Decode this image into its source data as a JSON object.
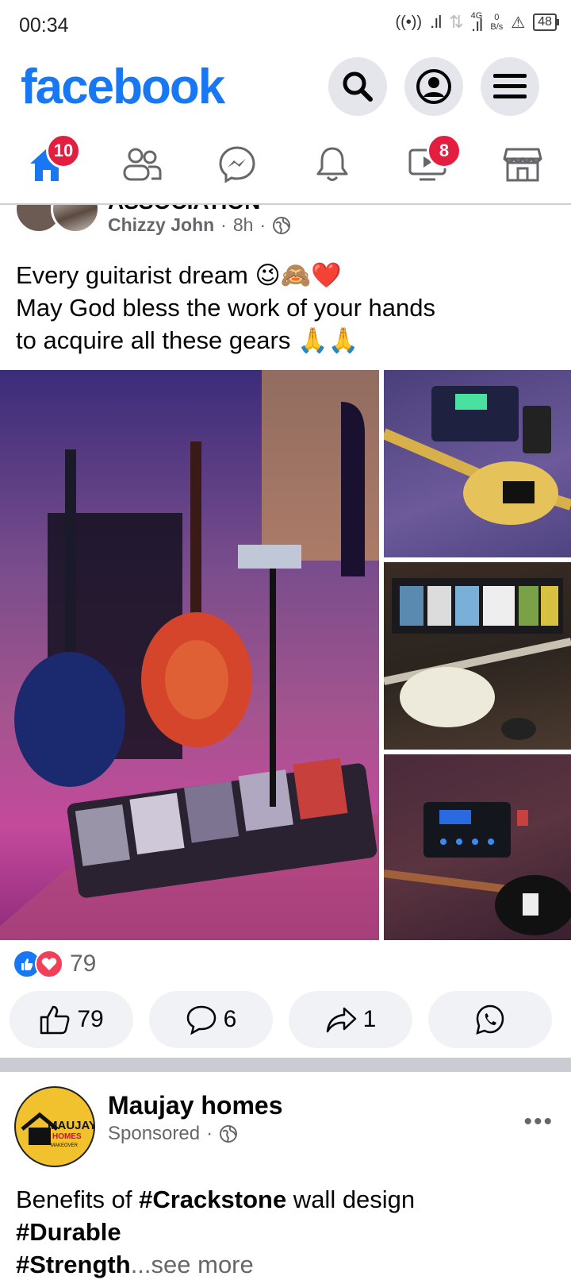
{
  "status_bar": {
    "time": "00:34",
    "network": "4G",
    "data_rate": "0",
    "data_rate_unit": "B/s",
    "battery": "48"
  },
  "header": {
    "logo": "facebook",
    "icons": [
      "search-icon",
      "profile-icon",
      "menu-icon"
    ]
  },
  "nav": {
    "home_badge": "10",
    "video_badge": "8",
    "icons": [
      "home-icon",
      "friends-icon",
      "messenger-icon",
      "notifications-icon",
      "video-icon",
      "marketplace-icon"
    ]
  },
  "post": {
    "group_name": "ASSOCIATION",
    "author": "Chizzy John",
    "time": "8h",
    "separator": "·",
    "text_lines": [
      "Every guitarist dream 😉🙈❤️",
      "May God bless the work of your hands",
      "to acquire all these gears 🙏🙏"
    ],
    "reaction_count": "79",
    "like_count": "79",
    "comment_count": "6",
    "share_count": "1"
  },
  "sponsored": {
    "name": "Maujay homes",
    "label": "Sponsored",
    "logo_text_1": "MAUJAY",
    "logo_text_2": "HOMES",
    "logo_text_3": "MAKEOVER",
    "more": "•••",
    "line1_prefix": "Benefits of ",
    "line1_tag": "#Crackstone",
    "line1_suffix": " wall design",
    "line2_tag": "#Durable",
    "line3_tag": "#Strength",
    "see_more": "...see more"
  },
  "colors": {
    "brand": "#1877f2",
    "badge": "#e41e3f",
    "muted": "#65676b"
  }
}
